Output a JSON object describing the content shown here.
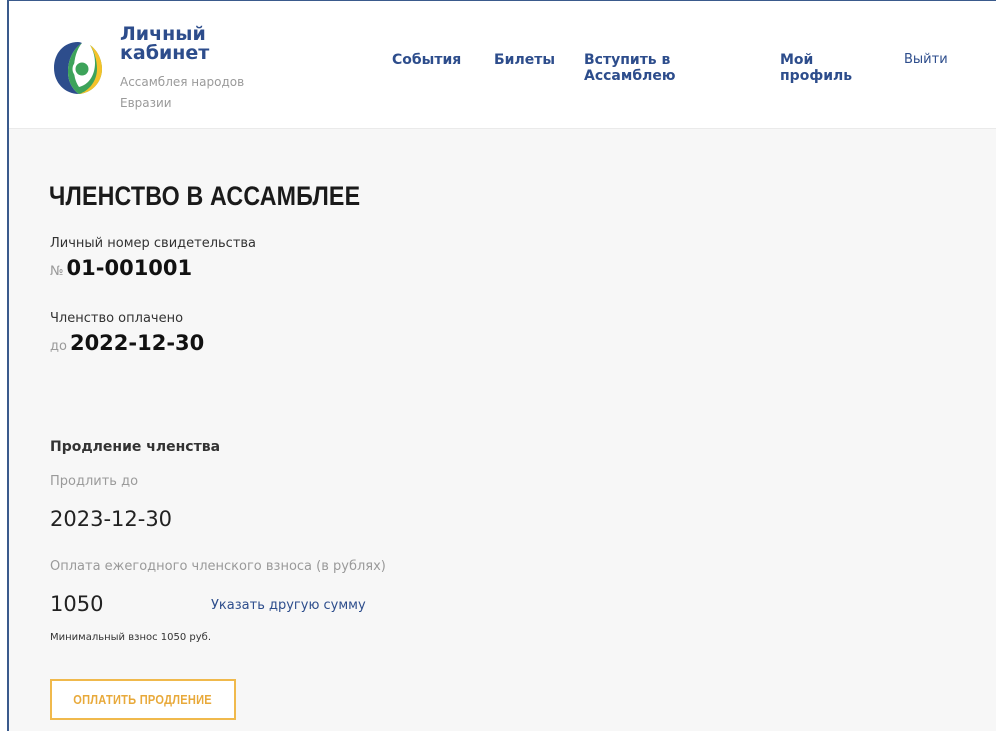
{
  "brand": {
    "title_line1": "Личный",
    "title_line2": "кабинет",
    "subtitle": "Ассамблея народов Евразии",
    "logo_icon": "assembly-logo-icon",
    "colors": {
      "blue": "#2d4d8c",
      "green": "#3da35a",
      "yellow": "#f5c22a",
      "orange": "#e8a93a"
    }
  },
  "nav": {
    "events": "События",
    "tickets": "Билеты",
    "join": "Вступить в Ассамблею",
    "profile": "Мой профиль",
    "logout": "Выйти"
  },
  "membership": {
    "title": "ЧЛЕНСТВО В АССАМБЛЕЕ",
    "certificate_label": "Личный номер свидетельства",
    "certificate_prefix": "№",
    "certificate_number": "01-001001",
    "paid_label": "Членство оплачено",
    "paid_prefix": "до",
    "paid_until": "2022-12-30"
  },
  "renewal": {
    "title": "Продление членства",
    "extend_label": "Продлить до",
    "extend_date": "2023-12-30",
    "fee_label": "Оплата ежегодного членского взноса (в рублях)",
    "fee_amount": "1050",
    "other_amount_link": "Указать другую сумму",
    "min_fee_note": "Минимальный взнос 1050 руб.",
    "pay_button": "ОПЛАТИТЬ ПРОДЛЕНИЕ"
  }
}
